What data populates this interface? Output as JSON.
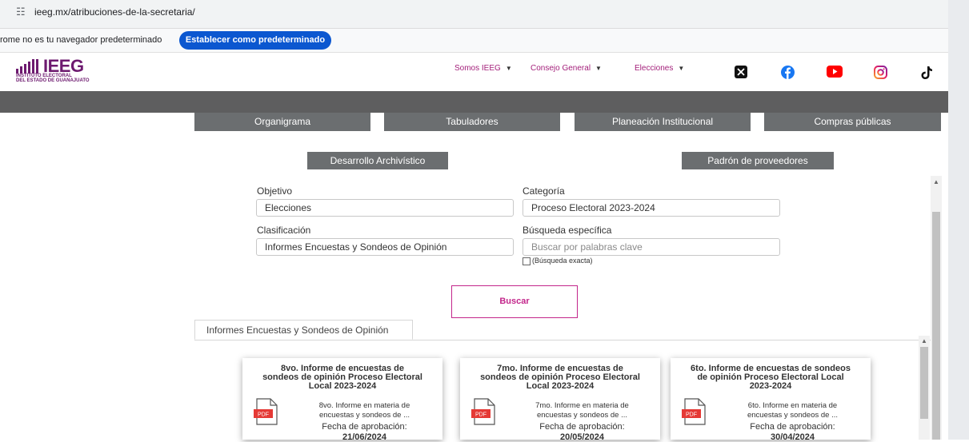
{
  "browser": {
    "url": "ieeg.mx/atribuciones-de-la-secretaria/",
    "infobar_message": "rome no es tu navegador predeterminado",
    "infobar_button": "Establecer como predeterminado"
  },
  "header": {
    "logo_text": "IEEG",
    "logo_sub1": "INSTITUTO ELECTORAL",
    "logo_sub2": "DEL ESTADO DE GUANAJUATO",
    "nav": [
      "Somos IEEG",
      "Consejo General",
      "Elecciones"
    ],
    "social_icons": [
      "x-icon",
      "facebook-icon",
      "youtube-icon",
      "instagram-icon",
      "tiktok-icon"
    ]
  },
  "sections": {
    "row1": [
      "Organigrama",
      "Tabuladores",
      "Planeación Institucional",
      "Compras públicas"
    ],
    "row2": [
      "Desarrollo Archivístico",
      "Padrón de proveedores"
    ]
  },
  "form": {
    "objetivo_label": "Objetivo",
    "objetivo_value": "Elecciones",
    "categoria_label": "Categoría",
    "categoria_value": "Proceso Electoral 2023-2024",
    "clasificacion_label": "Clasificación",
    "clasificacion_value": "Informes Encuestas y Sondeos de Opinión",
    "busqueda_label": "Búsqueda específica",
    "busqueda_placeholder": "Buscar por palabras clave",
    "exacta_label": "(Búsqueda exacta)",
    "buscar_button": "Buscar"
  },
  "results_tab": "Informes Encuestas y Sondeos de Opinión",
  "cards": [
    {
      "title_1": "8vo. Informe de encuestas de",
      "title_2": "sondeos de opinión Proceso Electoral",
      "title_3": "Local 2023-2024",
      "desc_1": "8vo. Informe en materia de",
      "desc_2": "encuestas y sondeos de ...",
      "fecha_label": "Fecha de aprobación:",
      "fecha": "21/06/2024"
    },
    {
      "title_1": "7mo. Informe de encuestas de",
      "title_2": "sondeos de opinión Proceso Electoral",
      "title_3": "Local 2023-2024",
      "desc_1": "7mo. Informe en materia de",
      "desc_2": "encuestas y sondeos de ...",
      "fecha_label": "Fecha de aprobación:",
      "fecha": "20/05/2024"
    },
    {
      "title_1": "6to. Informe de encuestas de sondeos",
      "title_2": "de opinión Proceso Electoral Local",
      "title_3": "2023-2024",
      "desc_1": "6to. Informe en materia de",
      "desc_2": "encuestas y sondeos de ...",
      "fecha_label": "Fecha de aprobación:",
      "fecha": "30/04/2024"
    }
  ],
  "pdf_label": "PDF",
  "colors": {
    "brand": "#6d1a6f",
    "accent": "#c3268b",
    "button_gray": "#6b6e70",
    "pdf_red": "#e53935"
  }
}
